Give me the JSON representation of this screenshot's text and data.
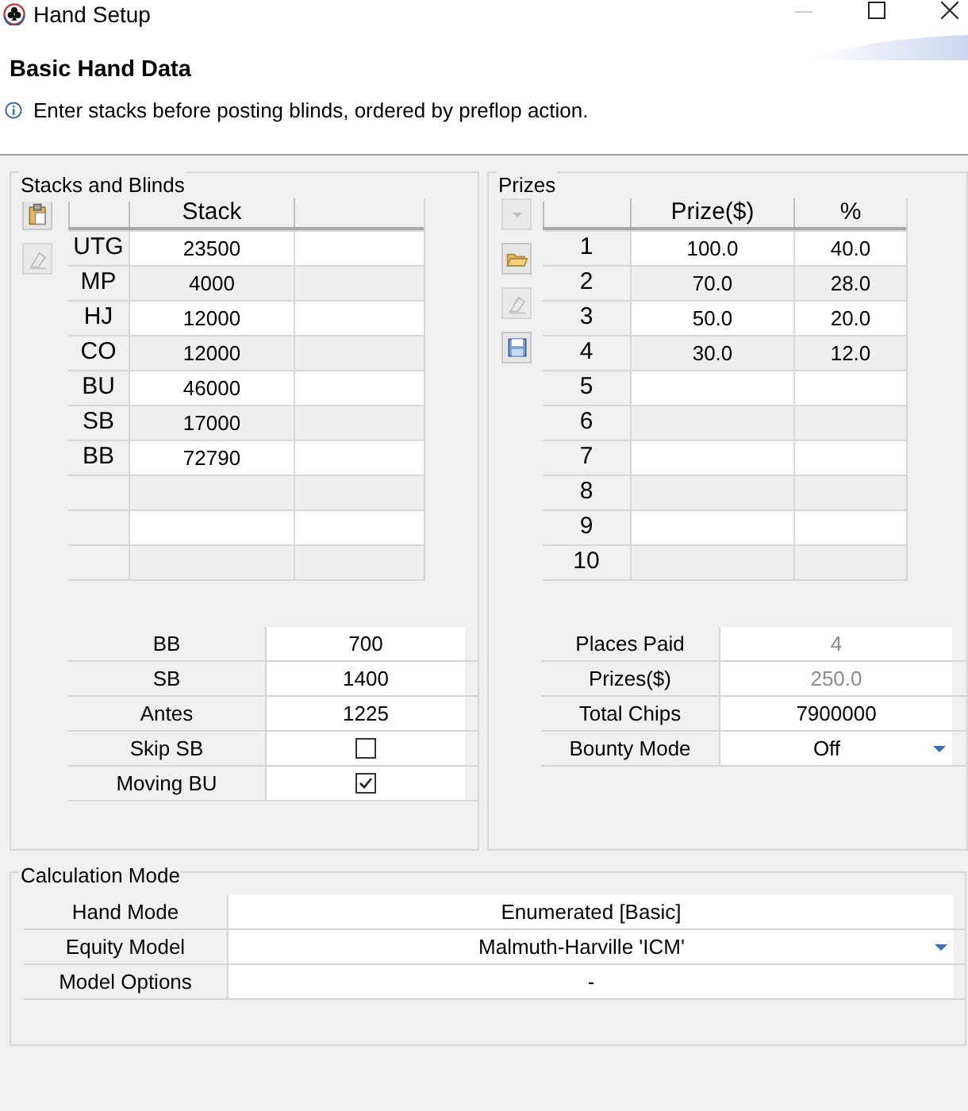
{
  "window": {
    "title": "Hand Setup"
  },
  "header": {
    "title": "Basic Hand Data",
    "message": "Enter stacks before posting blinds, ordered by preflop action."
  },
  "stacks_and_blinds": {
    "title": "Stacks and Blinds",
    "tools": [
      {
        "kind": "paste",
        "disabled": false
      },
      {
        "kind": "erase",
        "disabled": true
      }
    ],
    "columns": [
      "Stack"
    ],
    "rows": [
      {
        "position": "UTG",
        "stack": "23500"
      },
      {
        "position": "MP",
        "stack": "4000"
      },
      {
        "position": "HJ",
        "stack": "12000"
      },
      {
        "position": "CO",
        "stack": "12000"
      },
      {
        "position": "BU",
        "stack": "46000"
      },
      {
        "position": "SB",
        "stack": "17000"
      },
      {
        "position": "BB",
        "stack": "72790"
      },
      {},
      {},
      {}
    ],
    "properties": [
      {
        "kind": "text",
        "label": "BB",
        "value": "700"
      },
      {
        "kind": "text",
        "label": "SB",
        "value": "1400"
      },
      {
        "kind": "text",
        "label": "Antes",
        "value": "1225"
      },
      {
        "kind": "checkbox",
        "label": "Skip SB",
        "checked": false
      },
      {
        "kind": "checkbox",
        "label": "Moving BU",
        "checked": true
      }
    ]
  },
  "prizes": {
    "title": "Prizes",
    "tools": [
      {
        "kind": "dropdown",
        "disabled": true
      },
      {
        "kind": "open",
        "disabled": false
      },
      {
        "kind": "erase",
        "disabled": true
      },
      {
        "kind": "save",
        "disabled": false
      }
    ],
    "columns": [
      "Prize($)",
      "%"
    ],
    "rows": [
      {
        "place": "1",
        "prize": "100.0",
        "percent": "40.0"
      },
      {
        "place": "2",
        "prize": "70.0",
        "percent": "28.0"
      },
      {
        "place": "3",
        "prize": "50.0",
        "percent": "20.0"
      },
      {
        "place": "4",
        "prize": "30.0",
        "percent": "12.0"
      },
      {
        "place": "5"
      },
      {
        "place": "6"
      },
      {
        "place": "7"
      },
      {
        "place": "8"
      },
      {
        "place": "9"
      },
      {
        "place": "10"
      }
    ],
    "properties": [
      {
        "kind": "text",
        "label": "Places Paid",
        "value": "4",
        "disabled": true
      },
      {
        "kind": "text",
        "label": "Prizes($)",
        "value": "250.0",
        "disabled": true
      },
      {
        "kind": "text",
        "label": "Total Chips",
        "value": "7900000",
        "disabled": false
      },
      {
        "kind": "dropdown",
        "label": "Bounty Mode",
        "value": "Off",
        "disabled": false
      }
    ]
  },
  "calculation_mode": {
    "title": "Calculation Mode",
    "properties": [
      {
        "kind": "text",
        "label": "Hand Mode",
        "value": "Enumerated [Basic]"
      },
      {
        "kind": "dropdown",
        "label": "Equity Model",
        "value": "Malmuth-Harville 'ICM'"
      },
      {
        "kind": "text",
        "label": "Model Options",
        "value": "-"
      }
    ]
  }
}
